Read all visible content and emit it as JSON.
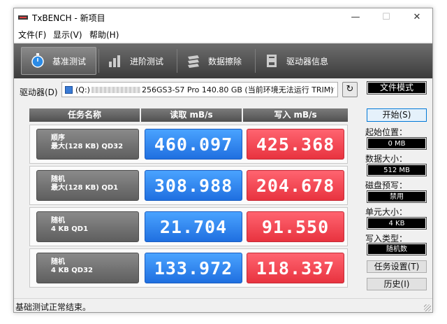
{
  "window": {
    "title": "TxBENCH - 新项目",
    "min_label": "—",
    "max_label": "☐",
    "close_label": "✕"
  },
  "menu": [
    "文件(F)",
    "显示(V)",
    "帮助(H)"
  ],
  "toolbar": {
    "tabs": [
      {
        "label": "基准测试",
        "icon": "stopwatch-icon",
        "active": true
      },
      {
        "label": "进阶测试",
        "icon": "bar-chart-icon",
        "active": false
      },
      {
        "label": "数据擦除",
        "icon": "erase-icon",
        "active": false
      },
      {
        "label": "驱动器信息",
        "icon": "drive-info-icon",
        "active": false
      }
    ]
  },
  "drive": {
    "label": "驱动器(D)",
    "selected_prefix": "(Q:)",
    "selected_suffix": "256GS3-S7 Pro  140.80 GB (当前环境无法运行 TRIM)",
    "mode_label": "文件模式"
  },
  "table": {
    "headers": [
      "任务名称",
      "读取 mB/s",
      "写入 mB/s"
    ],
    "rows": [
      {
        "name_line1": "顺序",
        "name_line2": "最大(128 KB) QD32",
        "read": "460.097",
        "write": "425.368"
      },
      {
        "name_line1": "随机",
        "name_line2": "最大(128 KB) QD1",
        "read": "308.988",
        "write": "204.678"
      },
      {
        "name_line1": "随机",
        "name_line2": "4 KB QD1",
        "read": "21.704",
        "write": "91.550"
      },
      {
        "name_line1": "随机",
        "name_line2": "4 KB QD32",
        "read": "133.972",
        "write": "118.337"
      }
    ]
  },
  "side": {
    "start_button": "开始(S)",
    "start_pos_label": "起始位置：",
    "start_pos_value": "0 MB",
    "data_size_label": "数据大小：",
    "data_size_value": "512 MB",
    "precondition_label": "磁盘预写：",
    "precondition_value": "禁用",
    "unit_size_label": "单元大小：",
    "unit_size_value": "4 KB",
    "write_type_label": "写入类型：",
    "write_type_value": "随机数",
    "settings_button": "任务设置(T)",
    "history_button": "历史(I)"
  },
  "status": {
    "text": "基础测试正常结束。"
  },
  "colors": {
    "read": "#1f6fe0",
    "write": "#e8333f",
    "toolbar": "#4a4a4a"
  }
}
